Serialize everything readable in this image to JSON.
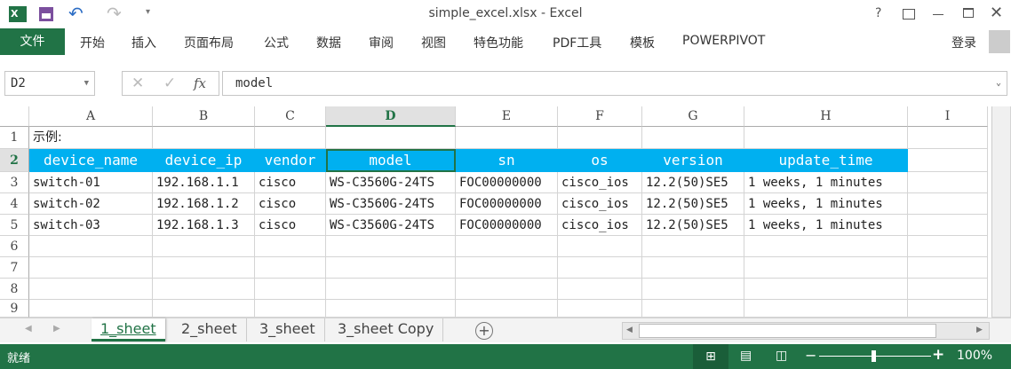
{
  "window": {
    "title": "simple_excel.xlsx - Excel",
    "help": "?",
    "login": "登录"
  },
  "ribbon": {
    "file": "文件",
    "tabs": [
      "开始",
      "插入",
      "页面布局",
      "公式",
      "数据",
      "审阅",
      "视图",
      "特色功能",
      "PDF工具",
      "模板",
      "POWERPIVOT"
    ]
  },
  "formula_bar": {
    "name_box": "D2",
    "fx": "fx",
    "value": "model"
  },
  "columns": [
    "A",
    "B",
    "C",
    "D",
    "E",
    "F",
    "G",
    "H",
    "I"
  ],
  "rows": [
    "1",
    "2",
    "3",
    "4",
    "5",
    "6",
    "7",
    "8",
    "9"
  ],
  "cells": {
    "r1": [
      "示例:"
    ],
    "header": [
      "device_name",
      "device_ip",
      "vendor",
      "model",
      "sn",
      "os",
      "version",
      "update_time"
    ],
    "data": [
      [
        "switch-01",
        "192.168.1.1",
        "cisco",
        "WS-C3560G-24TS",
        "FOC00000000",
        "cisco_ios",
        "12.2(50)SE5",
        "1 weeks, 1 minutes"
      ],
      [
        "switch-02",
        "192.168.1.2",
        "cisco",
        "WS-C3560G-24TS",
        "FOC00000000",
        "cisco_ios",
        "12.2(50)SE5",
        "1 weeks, 1 minutes"
      ],
      [
        "switch-03",
        "192.168.1.3",
        "cisco",
        "WS-C3560G-24TS",
        "FOC00000000",
        "cisco_ios",
        "12.2(50)SE5",
        "1 weeks, 1 minutes"
      ]
    ]
  },
  "sheets": [
    "1_sheet",
    "2_sheet",
    "3_sheet",
    "3_sheet Copy"
  ],
  "active_sheet": "1_sheet",
  "status": {
    "text": "就绪",
    "zoom": "100%"
  },
  "colors": {
    "excel_green": "#217346",
    "header_fill": "#00b0f0"
  }
}
